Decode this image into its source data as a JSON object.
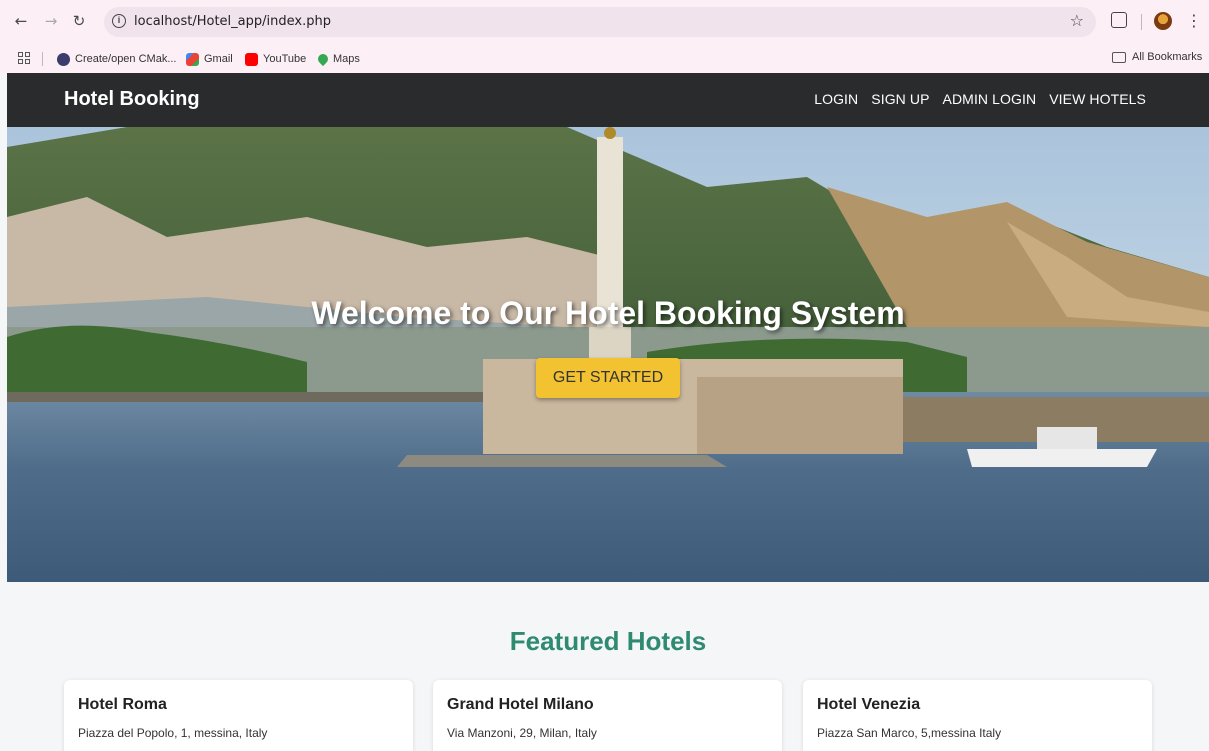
{
  "browser": {
    "url": "localhost/Hotel_app/index.php",
    "bookmarks": [
      {
        "label": "Create/open CMak...",
        "color": "#3b3b6e"
      },
      {
        "label": "Gmail",
        "color": "#ea4335"
      },
      {
        "label": "YouTube",
        "color": "#ff0000"
      },
      {
        "label": "Maps",
        "color": "#34a853"
      }
    ],
    "all_bookmarks": "All Bookmarks"
  },
  "navbar": {
    "brand": "Hotel Booking",
    "links": [
      "LOGIN",
      "SIGN UP",
      "ADMIN LOGIN",
      "VIEW HOTELS"
    ]
  },
  "hero": {
    "title": "Welcome to Our Hotel Booking System",
    "cta_label": "GET STARTED"
  },
  "featured": {
    "title": "Featured Hotels",
    "hotels": [
      {
        "name": "Hotel Roma",
        "address": "Piazza del Popolo, 1, messina, Italy"
      },
      {
        "name": "Grand Hotel Milano",
        "address": "Via Manzoni, 29, Milan, Italy"
      },
      {
        "name": "Hotel Venezia",
        "address": "Piazza San Marco, 5,messina Italy"
      }
    ]
  },
  "colors": {
    "navbar_bg": "#2a2b2c",
    "cta_bg": "#f2c230",
    "featured_title": "#2f8a72"
  }
}
